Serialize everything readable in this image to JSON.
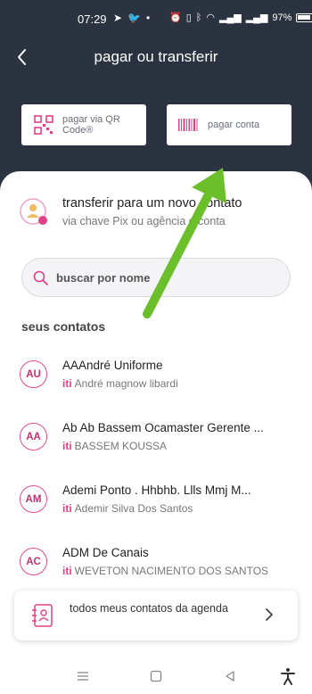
{
  "status_bar": {
    "time": "07:29",
    "battery": "97%"
  },
  "header": {
    "title": "pagar ou transferir"
  },
  "actions": {
    "qr": {
      "label_line1": "pagar via QR",
      "label_line2": "Code®"
    },
    "bill": {
      "label": "pagar conta"
    }
  },
  "new_contact": {
    "title": "transferir para um novo contato",
    "subtitle": "via chave Pix ou agência e conta"
  },
  "search": {
    "placeholder": "buscar por nome"
  },
  "contacts_section": {
    "title": "seus contatos"
  },
  "contacts": [
    {
      "initials": "AU",
      "name": "AAAndré Uniforme",
      "tag": "iti",
      "subname": "André magnow libardi"
    },
    {
      "initials": "AA",
      "name": "Ab Ab Bassem Ocamaster Gerente ...",
      "tag": "iti",
      "subname": "BASSEM KOUSSA"
    },
    {
      "initials": "AM",
      "name": "Ademi Ponto . Hhbhb. Llls Mmj M...",
      "tag": "iti",
      "subname": "Ademir Silva Dos Santos"
    },
    {
      "initials": "AC",
      "name": "ADM De Canais",
      "tag": "iti",
      "subname": "WEVETON NACIMENTO DOS SANTOS"
    }
  ],
  "agenda": {
    "label": "todos meus contatos da agenda"
  },
  "colors": {
    "header_bg": "#2c3340",
    "accent": "#e0408a",
    "arrow": "#6abf2a"
  }
}
